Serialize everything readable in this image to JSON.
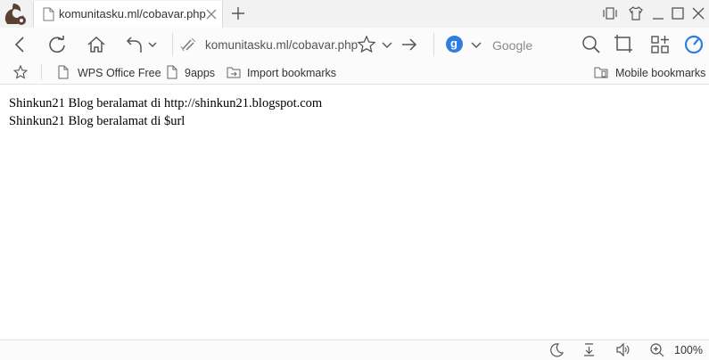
{
  "tab": {
    "title": "komunitasku.ml/cobavar.php"
  },
  "toolbar": {
    "url": "komunitasku.ml/cobavar.php",
    "search_engine_letter": "g",
    "search_placeholder": "Google"
  },
  "bookmarks": {
    "items": [
      {
        "label": "WPS Office Free",
        "icon": "page-icon"
      },
      {
        "label": "9apps",
        "icon": "page-icon"
      },
      {
        "label": "Import bookmarks",
        "icon": "import-icon"
      }
    ],
    "mobile_label": "Mobile bookmarks"
  },
  "content": {
    "lines": [
      "Shinkun21 Blog beralamat di http://shinkun21.blogspot.com",
      "Shinkun21 Blog beralamat di $url"
    ]
  },
  "status": {
    "zoom": "100%"
  },
  "colors": {
    "accent": "#2f7de1",
    "logo": "#5a4032"
  }
}
